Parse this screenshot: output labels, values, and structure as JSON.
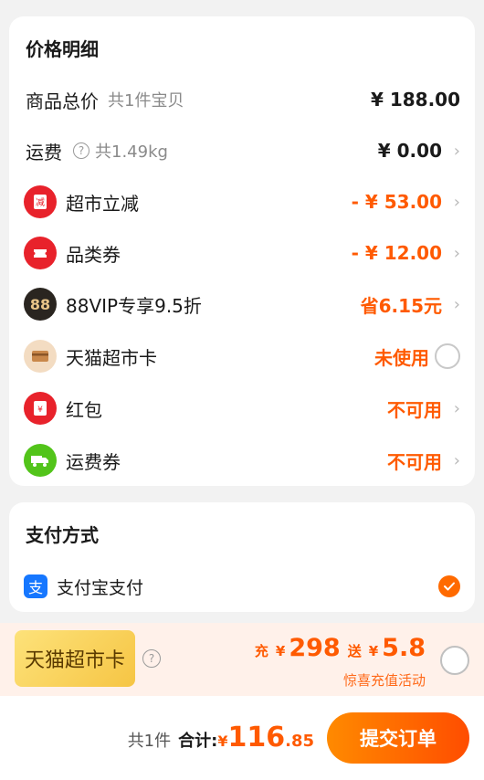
{
  "price_details": {
    "title": "价格明细",
    "rows": [
      {
        "label": "商品总价",
        "sub": "共1件宝贝",
        "value": "¥ 188.00"
      },
      {
        "label": "运费",
        "sub": "共1.49kg",
        "value": "¥ 0.00"
      },
      {
        "label": "超市立减",
        "value": "- ¥ 53.00",
        "icon": "reduce-icon"
      },
      {
        "label": "品类券",
        "value": "- ¥ 12.00",
        "icon": "coupon-icon"
      },
      {
        "label": "88VIP专享9.5折",
        "value": "省6.15元",
        "icon": "88vip-icon",
        "icon_text": "88"
      },
      {
        "label": "天猫超市卡",
        "value": "未使用",
        "icon": "card-icon"
      },
      {
        "label": "红包",
        "value": "不可用",
        "icon": "red-envelope-icon"
      },
      {
        "label": "运费券",
        "value": "不可用",
        "icon": "truck-icon"
      }
    ]
  },
  "payment": {
    "title": "支付方式",
    "method": "支付宝支付",
    "icon_char": "支"
  },
  "promo": {
    "card_label": "天猫超市卡",
    "charge_label": "充",
    "charge_currency": "¥",
    "charge_amount": "298",
    "gift_label": "送",
    "gift_currency": "¥",
    "gift_amount": "5.8",
    "subtitle": "惊喜充值活动"
  },
  "bottom_bar": {
    "count": "共1件",
    "total_label": "合计:",
    "currency": "¥",
    "total_int": "116",
    "total_dec": ".85",
    "submit_label": "提交订单"
  },
  "colors": {
    "accent": "#ff5a00",
    "alipay_blue": "#1677ff",
    "red_icon": "#e8222b",
    "green_icon": "#52c41a",
    "gold_card": "#f6c544"
  }
}
